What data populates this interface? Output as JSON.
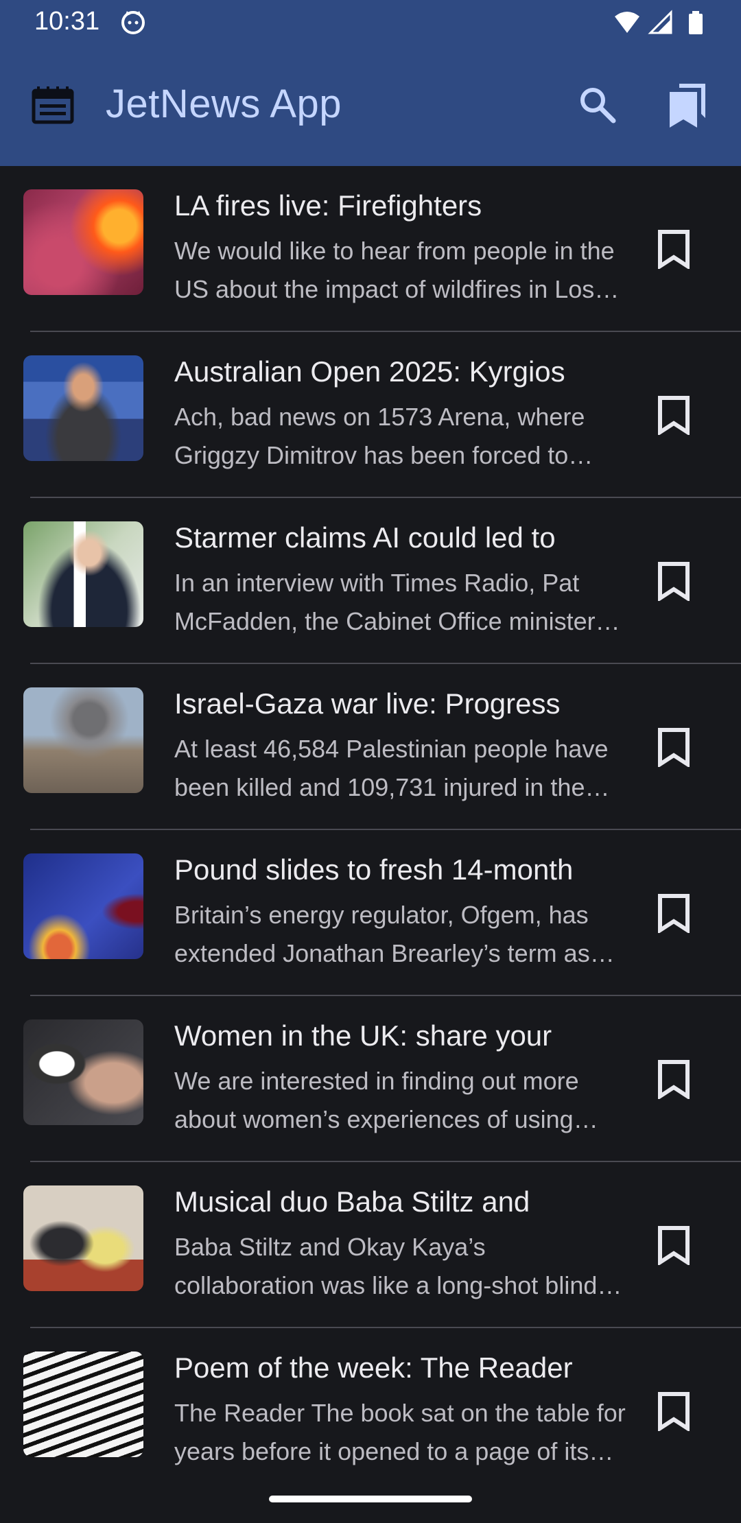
{
  "status_bar": {
    "time": "10:31",
    "icons": [
      "cat-notification-icon",
      "wifi-icon",
      "signal-icon",
      "battery-icon"
    ]
  },
  "app_bar": {
    "title": "JetNews App",
    "icons": [
      "newspaper-logo-icon",
      "search-icon",
      "bookmarks-icon"
    ]
  },
  "articles": [
    {
      "title": "LA fires live: Firefighters",
      "description": "We would like to hear from people in the US about the impact of wildfires in Los Angeles",
      "thumbnail": "wildfire-photo"
    },
    {
      "title": "Australian Open 2025: Kyrgios",
      "description": "Ach, bad news on 1573 Arena, where Griggzy Dimitrov has been forced to retire",
      "thumbnail": "tennis-player-photo"
    },
    {
      "title": "Starmer claims AI could led to",
      "description": "In an interview with Times Radio, Pat McFadden, the Cabinet Office minister said",
      "thumbnail": "politician-photo"
    },
    {
      "title": "Israel-Gaza war live: Progress",
      "description": "At least 46,584 Palestinian people have been killed and 109,731 injured in the war",
      "thumbnail": "smoke-over-city-photo"
    },
    {
      "title": "Pound slides to fresh 14-month",
      "description": "Britain’s energy regulator, Ofgem, has extended Jonathan Brearley’s term as chief executive",
      "thumbnail": "press-conference-photo"
    },
    {
      "title": "Women in the UK: share your",
      "description": "We are interested in finding out more about women’s experiences of using apps",
      "thumbnail": "phone-in-hand-photo"
    },
    {
      "title": "Musical duo Baba Stiltz and",
      "description": "Baba Stiltz and Okay Kaya’s collaboration was like a long-shot blind date",
      "thumbnail": "musical-duo-photo"
    },
    {
      "title": "Poem of the week: The Reader",
      "description": "The Reader The book sat on the table for years before it opened to a page of its own",
      "thumbnail": "ink-drawing-photo"
    }
  ],
  "colors": {
    "app_bar": "#2f4a82",
    "title": "#c5d6ff",
    "background": "#17181c",
    "item_title": "#ecebef",
    "item_desc": "#bdbcc3"
  }
}
